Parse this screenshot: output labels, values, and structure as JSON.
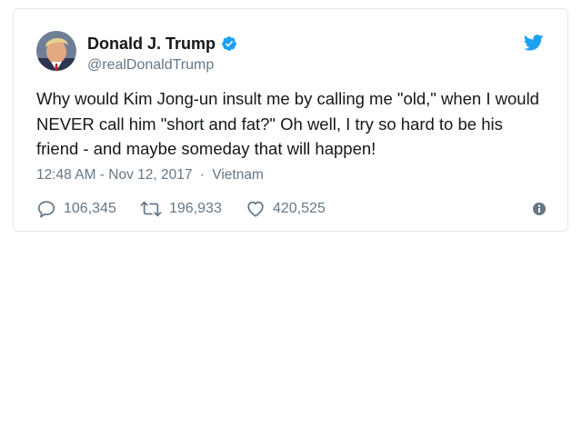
{
  "tweet": {
    "author": {
      "display_name": "Donald J. Trump",
      "handle": "@realDonaldTrump",
      "verified": true,
      "avatar_icon": "profile-photo"
    },
    "text": "Why would Kim Jong-un insult me by calling me \"old,\" when I would NEVER call him \"short and fat?\" Oh well, I try so hard to be his friend - and maybe someday that will happen!",
    "time": "12:48 AM - Nov 12, 2017",
    "separator": "·",
    "location": "Vietnam",
    "stats": {
      "replies": "106,345",
      "retweets": "196,933",
      "likes": "420,525"
    }
  },
  "icons": {
    "verified": "verified-badge-icon",
    "brand": "twitter-bird-icon",
    "reply": "reply-icon",
    "retweet": "retweet-icon",
    "like": "heart-icon",
    "info": "info-icon"
  },
  "colors": {
    "brand": "#1da1f2",
    "secondary_text": "#657786",
    "primary_text": "#14171a",
    "border": "#e1e8ed"
  }
}
